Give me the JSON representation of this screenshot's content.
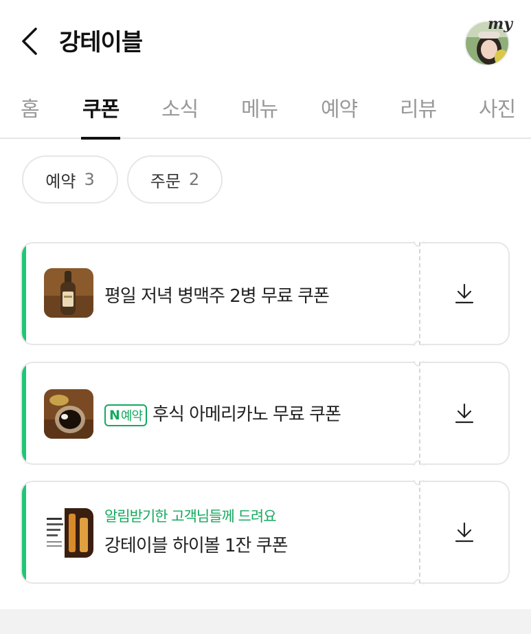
{
  "header": {
    "title": "강테이블",
    "avatar_badge": "my"
  },
  "tabs": [
    {
      "label": "홈",
      "active": false
    },
    {
      "label": "쿠폰",
      "active": true
    },
    {
      "label": "소식",
      "active": false
    },
    {
      "label": "메뉴",
      "active": false
    },
    {
      "label": "예약",
      "active": false
    },
    {
      "label": "리뷰",
      "active": false
    },
    {
      "label": "사진",
      "active": false
    }
  ],
  "filters": [
    {
      "label": "예약",
      "count": "3"
    },
    {
      "label": "주문",
      "count": "2"
    }
  ],
  "coupons": [
    {
      "title": "평일 저녁 병맥주 2병 무료 쿠폰",
      "badge": "",
      "subtitle": "",
      "thumb": "beer-bottle"
    },
    {
      "title": "후식 아메리카노 무료 쿠폰",
      "badge": {
        "mark": "N",
        "label": "예약"
      },
      "subtitle": "",
      "thumb": "americano"
    },
    {
      "title": "강테이블 하이볼 1잔 쿠폰",
      "badge": "",
      "subtitle": "알림받기한 고객님들께 드려요",
      "thumb": "highball-poster"
    }
  ],
  "colors": {
    "accent": "#1ec675",
    "accent_text": "#14a95d",
    "border": "#e6e6e6",
    "text": "#111111",
    "muted": "#999999"
  },
  "icons": {
    "back": "chevron-left-icon",
    "download": "download-icon"
  }
}
